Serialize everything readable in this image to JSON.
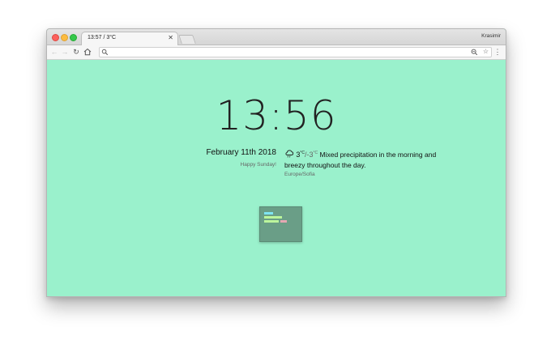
{
  "window": {
    "tab_title": "13:57 / 3°C",
    "profile_name": "Krasimir"
  },
  "toolbar": {
    "url": ""
  },
  "page": {
    "time": "13:56",
    "date": "February 11th 2018",
    "greeting": "Happy Sunday!",
    "weather": {
      "icon": "cloud-rain-icon",
      "temp_high": "3",
      "unit": "°C",
      "separator": "/",
      "temp_low": "-3",
      "summary": "Mixed precipitation in the morning and breezy throughout the day.",
      "timezone": "Europe/Sofia"
    }
  },
  "colors": {
    "background": "#9af1cc",
    "widget": "#6a9e87",
    "widget_bar_cyan": "#7fe4f2",
    "widget_bar_green": "#bcf59c",
    "widget_bar_pink": "#e4a8b2"
  }
}
